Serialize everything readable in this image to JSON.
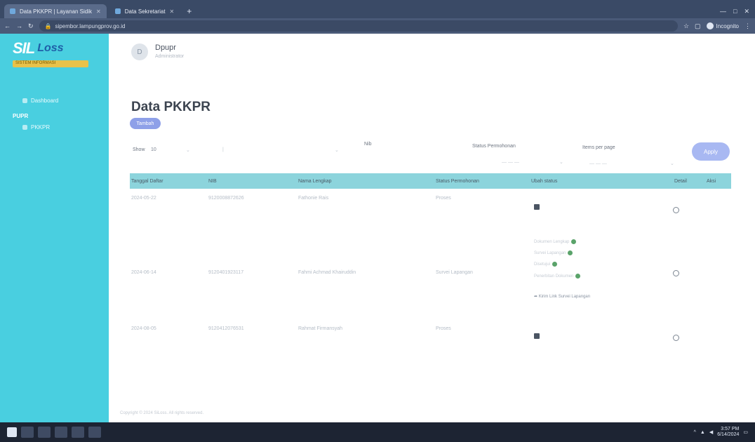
{
  "browser": {
    "tabs": [
      {
        "label": "Data PKKPR | Layanan Sidik",
        "active": true
      },
      {
        "label": "Data Sekretariat",
        "active": false
      }
    ],
    "new_tab": "+",
    "url": "sipembor.lampungprov.go.id",
    "profile_label": "Incognito",
    "window_controls": [
      "—",
      "□",
      "✕"
    ]
  },
  "sidebar": {
    "logo_mark": "SIL",
    "logo_text": "Loss",
    "logo_sub": "SISTEM INFORMASI",
    "items": [
      {
        "type": "item",
        "label": "Dashboard"
      },
      {
        "type": "group",
        "label": "PUPR"
      },
      {
        "type": "item",
        "label": "PKKPR"
      }
    ]
  },
  "topbar": {
    "user_initial": "D",
    "user_name": "Dpupr",
    "user_role": "Administrator"
  },
  "page": {
    "title": "Data PKKPR",
    "add_button": "Tambah"
  },
  "filters": {
    "show_label": "Show",
    "show_value": "10",
    "nib_label": "Nib",
    "status_label": "Status Permohonan",
    "items_per_page_label": "Items per page",
    "apply_button": "Apply"
  },
  "table": {
    "columns": [
      "Tanggal Daftar",
      "NIB",
      "Nama Lengkap",
      "Status Permohonan",
      "Ubah status",
      "Detail",
      "Aksi"
    ],
    "rows": [
      {
        "date": "2024-05-22",
        "nib": "9120008872626",
        "name": "Fathonie Rais",
        "status": "Proses",
        "kind": "icon"
      },
      {
        "date": "2024-06-14",
        "nib": "9120401923117",
        "name": "Fahmi Achmad Khairuddin",
        "status": "Survei Lapangan",
        "kind": "list",
        "steps": [
          "Dokumen Lengkap",
          "Survei Lapangan",
          "Disetujui",
          "Penerbitan Dokumen"
        ],
        "share": "Kirim Link Survei Lapangan"
      },
      {
        "date": "2024-08-05",
        "nib": "9120412076531",
        "name": "Rahmat Firmansyah",
        "status": "Proses",
        "kind": "icon"
      }
    ]
  },
  "footer": "Copyright © 2024 SiLoss. All rights reserved.",
  "taskbar": {
    "time": "3:57 PM",
    "date": "6/14/2024"
  }
}
